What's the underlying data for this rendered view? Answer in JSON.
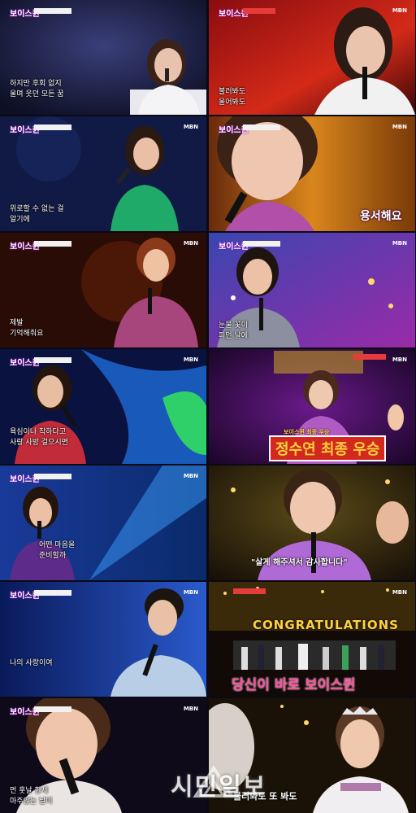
{
  "show": {
    "logo": "보이스퀸",
    "channel": "MBN"
  },
  "subtitles": {
    "p1": "하지만 후회 없지\n울며 웃던 모든 꿈",
    "p2": "불러봐도\n울어봐도",
    "p3": "위로할 수 없는 걸\n알기에",
    "p4": "용서해요",
    "p5": "제발\n기억해줘요",
    "p6": "눈물 꽃이\n피던 날에",
    "p7": "욕심이나 착하다고\n사랑 사방 걸으시면",
    "p8": "정수연 최종 우승",
    "p9": "어떤 마음을\n준비할까",
    "p10": "\"살게 해주셔서 감사합니다\"",
    "p11": "나의 사랑이여",
    "p12": "당신이 바로 보이스퀸",
    "p12_banner": "CONGRATULATIONS",
    "p13": "먼 훗날 한세\n마주앉는 날이",
    "p14": "불러봐도 또 봐도"
  },
  "winner_tag": "보이스퀸 최종 우승",
  "watermark": "시민일보",
  "colors": {
    "gold": "#ffd23c",
    "pink": "#ff4f9a",
    "red": "#d2281e"
  }
}
